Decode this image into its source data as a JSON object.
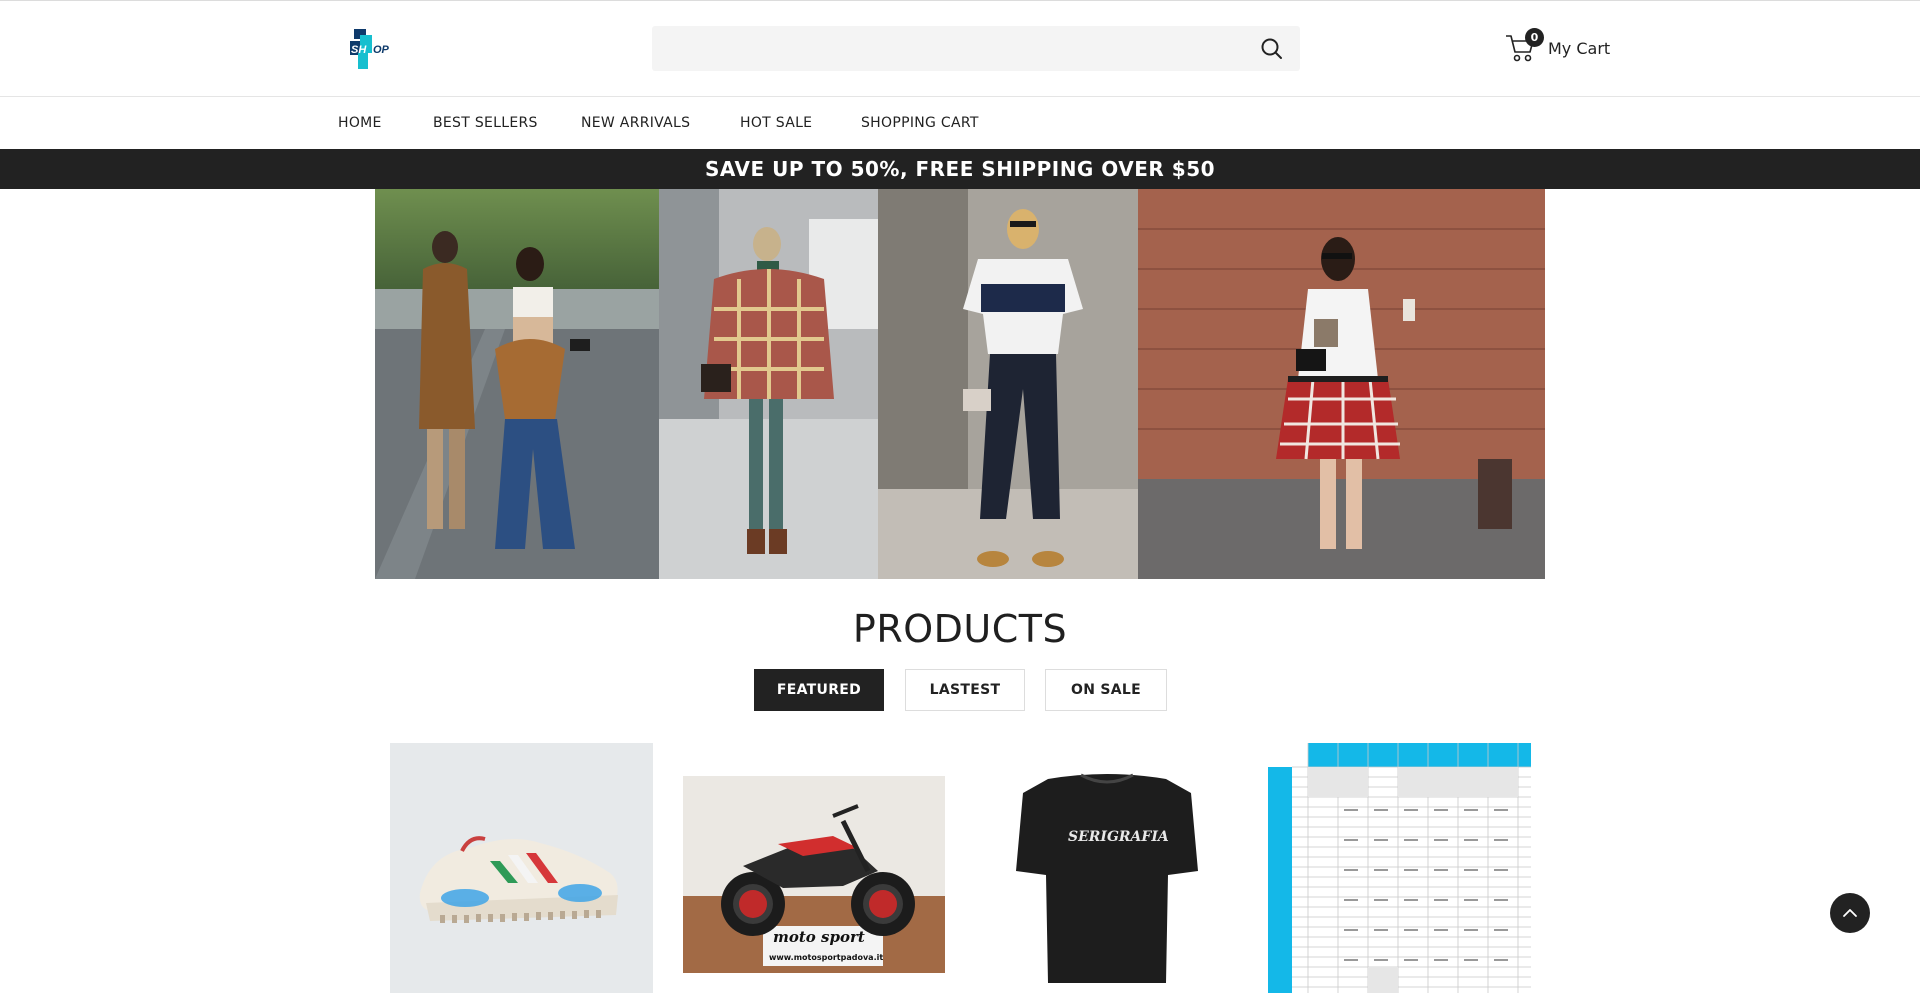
{
  "header": {
    "logo_text": "SHOP",
    "search": {
      "placeholder": "",
      "value": ""
    },
    "cart": {
      "count": "0",
      "label": "My Cart"
    }
  },
  "nav": {
    "items": [
      {
        "label": "HOME"
      },
      {
        "label": "BEST SELLERS"
      },
      {
        "label": "NEW ARRIVALS"
      },
      {
        "label": "HOT SALE"
      },
      {
        "label": "SHOPPING CART"
      }
    ]
  },
  "promo": {
    "text": "SAVE UP TO 50%, FREE SHIPPING OVER $50"
  },
  "products": {
    "title": "PRODUCTS",
    "tabs": [
      {
        "label": "FEATURED",
        "active": true
      },
      {
        "label": "LASTEST",
        "active": false
      },
      {
        "label": "ON SALE",
        "active": false
      }
    ],
    "items": [
      {
        "image": "sneaker"
      },
      {
        "image": "motorcycle",
        "caption": "www.motosportpadova.it",
        "brand": "moto sport"
      },
      {
        "image": "t-shirt",
        "print": "SERIGRAFIA"
      },
      {
        "image": "size-chart"
      }
    ]
  },
  "colors": {
    "accent": "#222222",
    "promo_bg": "#222222",
    "logo_teal": "#17bfcf",
    "logo_navy": "#0e3a6b",
    "chart_header": "#14b8e8"
  },
  "icons": {
    "search": "search-icon",
    "cart": "cart-icon",
    "back_to_top": "chevron-up-icon"
  }
}
